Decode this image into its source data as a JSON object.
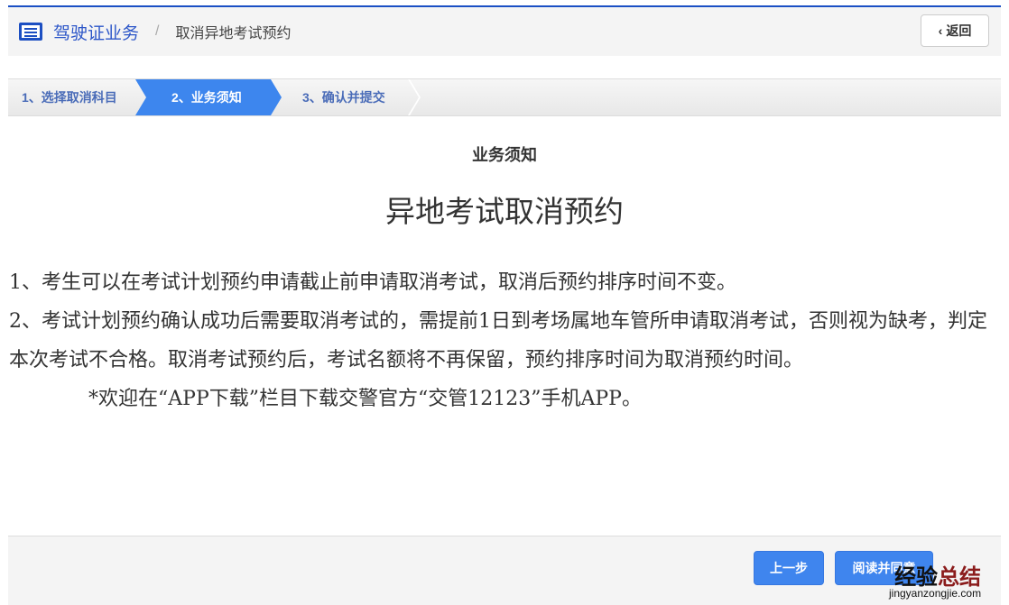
{
  "header": {
    "crumb_root": "驾驶证业务",
    "separator": "/",
    "crumb_current": "取消异地考试预约",
    "back_label": "返回"
  },
  "steps": [
    {
      "label": "1、选择取消科目"
    },
    {
      "label": "2、业务须知"
    },
    {
      "label": "3、确认并提交"
    }
  ],
  "content": {
    "subtitle": "业务须知",
    "title": "异地考试取消预约",
    "paragraphs": [
      "1、考生可以在考试计划预约申请截止前申请取消考试，取消后预约排序时间不变。",
      "2、考试计划预约确认成功后需要取消考试的，需提前1日到考场属地车管所申请取消考试，否则视为缺考，判定本次考试不合格。取消考试预约后，考试名额将不再保留，预约排序时间为取消预约时间。"
    ],
    "note": "*欢迎在“APP下载”栏目下载交警官方“交管12123”手机APP。"
  },
  "footer": {
    "prev_label": "上一步",
    "agree_label": "阅读并同意"
  },
  "watermark": {
    "part1": "经验",
    "part2": "总结",
    "url": "jingyanzongjie.com"
  }
}
